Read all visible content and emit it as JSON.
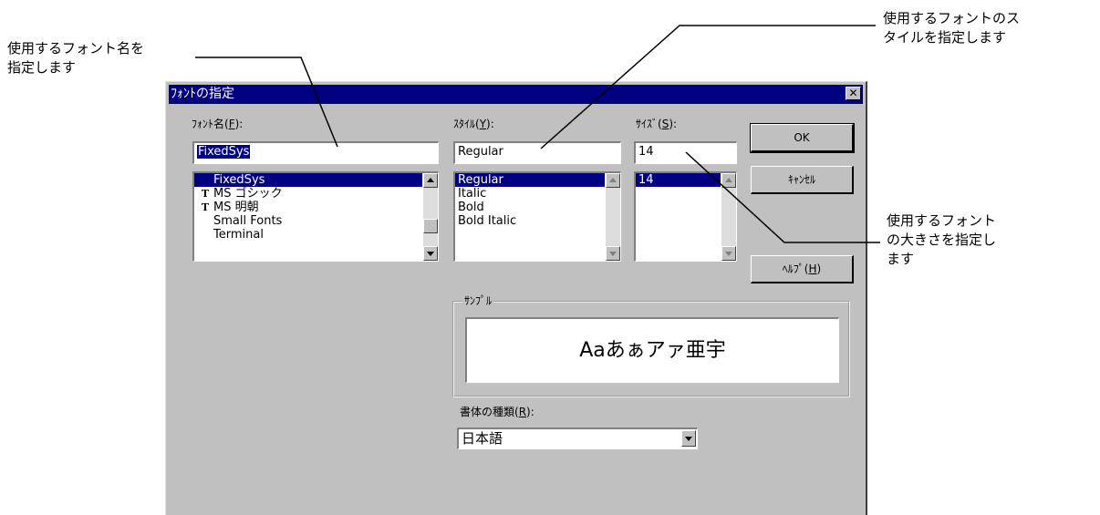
{
  "callouts": {
    "font_name": [
      "使用するフォント名を",
      "指定します"
    ],
    "style": [
      "使用するフォントのス",
      "タイルを指定します"
    ],
    "size": [
      "使用するフォント",
      "の大きさを指定し",
      "ます"
    ]
  },
  "dialog": {
    "title": "ﾌｫﾝﾄの指定",
    "close_glyph": "✕",
    "font_label": "ﾌｫﾝﾄ名(",
    "font_label_key": "F",
    "font_label_end": "):",
    "font_value": "FixedSys",
    "font_items": [
      {
        "label": "FixedSys",
        "truetype": false,
        "selected": true
      },
      {
        "label": "MS ゴシック",
        "truetype": true,
        "selected": false
      },
      {
        "label": "MS 明朝",
        "truetype": true,
        "selected": false
      },
      {
        "label": "Small Fonts",
        "truetype": false,
        "selected": false
      },
      {
        "label": "Terminal",
        "truetype": false,
        "selected": false
      }
    ],
    "truetype_glyph": "T",
    "style_label": "ｽﾀｲﾙ(",
    "style_label_key": "Y",
    "style_label_end": "):",
    "style_value": "Regular",
    "style_items": [
      "Regular",
      "Italic",
      "Bold",
      "Bold Italic"
    ],
    "style_selected": "Regular",
    "size_label": "ｻｲｽﾞ(",
    "size_label_key": "S",
    "size_label_end": "):",
    "size_value": "14",
    "size_items": [
      "14"
    ],
    "ok_label": "OK",
    "cancel_label": "ｷｬﾝｾﾙ",
    "help_label": "ﾍﾙﾌﾟ(",
    "help_label_key": "H",
    "help_label_end": ")",
    "sample_group_label": "ｻﾝﾌﾟﾙ",
    "sample_text": "Aaあぁアァ亜宇",
    "script_label": "書体の種類(",
    "script_label_key": "R",
    "script_label_end": "):",
    "script_value": "日本語"
  },
  "colors": {
    "titlebar": "#000080",
    "dialog_face": "#c0c0c0",
    "selection": "#000080"
  }
}
